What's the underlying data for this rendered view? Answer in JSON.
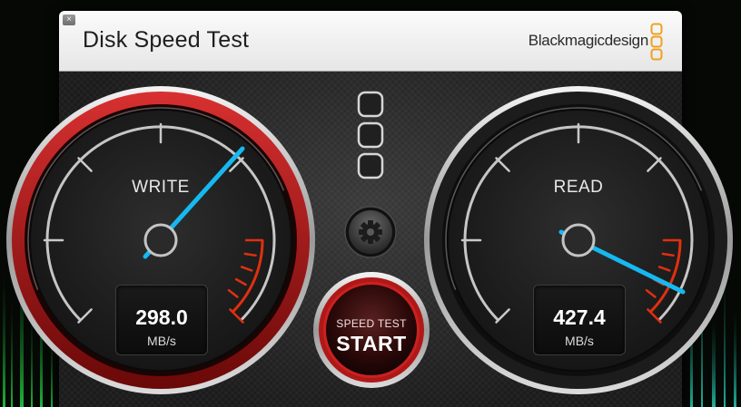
{
  "window": {
    "title": "Disk Speed Test",
    "close_label": "×",
    "brand": "Blackmagicdesign"
  },
  "gauges": {
    "write": {
      "label": "WRITE",
      "value": "298.0",
      "unit": "MB/s"
    },
    "read": {
      "label": "READ",
      "value": "427.4",
      "unit": "MB/s"
    }
  },
  "start_button": {
    "line1": "SPEED TEST",
    "line2": "START"
  },
  "icons": {
    "close": "close-icon",
    "brand_logo": "blackmagic-logo-icon",
    "status_lights": "status-light-icon",
    "settings": "gear-icon"
  },
  "colors": {
    "needle": "#16b8f0",
    "redline": "#e03010",
    "start_ring": "#b01818",
    "brand_orange": "#f0a020"
  }
}
